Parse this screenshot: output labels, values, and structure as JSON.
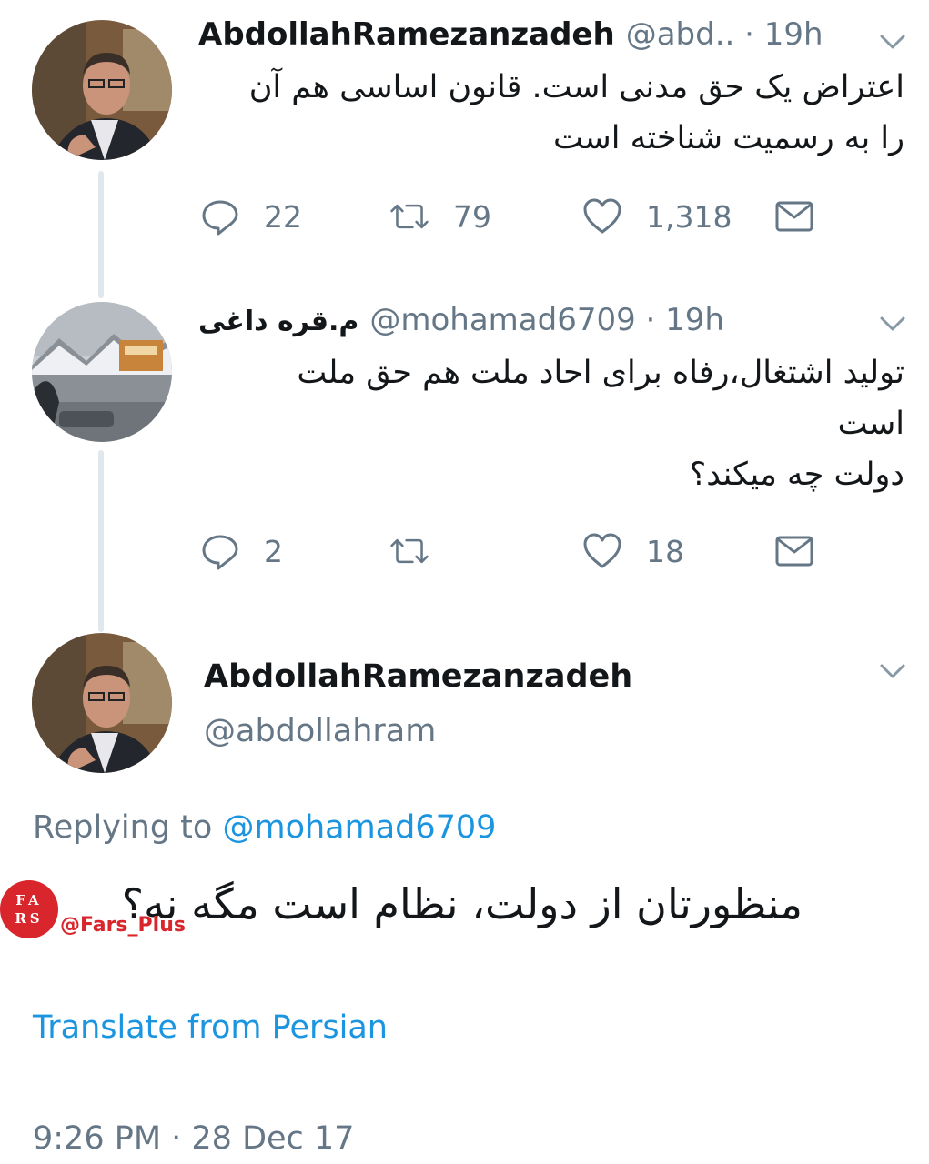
{
  "tweets": [
    {
      "name": "AbdollahRamezanzadeh",
      "handle_meta": "@abd.. · 19h",
      "lines": [
        "اعتراض یک حق مدنی است. قانون اساسی هم آن",
        "را به رسمیت شناخته است"
      ],
      "replies": "22",
      "retweets": "79",
      "likes": "1,318"
    },
    {
      "name": "م.قره داغی",
      "handle_meta": "@mohamad6709 · 19h",
      "lines": [
        "تولید اشتغال،رفاه برای احاد ملت هم حق ملت",
        "است",
        "دولت چه میکند؟"
      ],
      "replies": "2",
      "retweets": "",
      "likes": "18"
    }
  ],
  "main": {
    "name": "AbdollahRamezanzadeh",
    "handle": "@abdollahram",
    "replying_prefix": "Replying to",
    "replying_handle": "@mohamad6709",
    "text": "منظورتان از دولت، نظام است مگه نه؟",
    "translate": "Translate from Persian",
    "timestamp": "9:26 PM · 28 Dec 17"
  },
  "watermark": {
    "logo_text": "FARS",
    "handle": "@Fars_Plus"
  },
  "icons": {
    "reply": "reply-icon",
    "retweet": "retweet-icon",
    "like": "heart-icon",
    "dm": "envelope-icon",
    "menu": "chevron-down-icon"
  },
  "colors": {
    "link": "#1b95e0",
    "secondary": "#657786",
    "thread_line": "#e1e8ed"
  }
}
